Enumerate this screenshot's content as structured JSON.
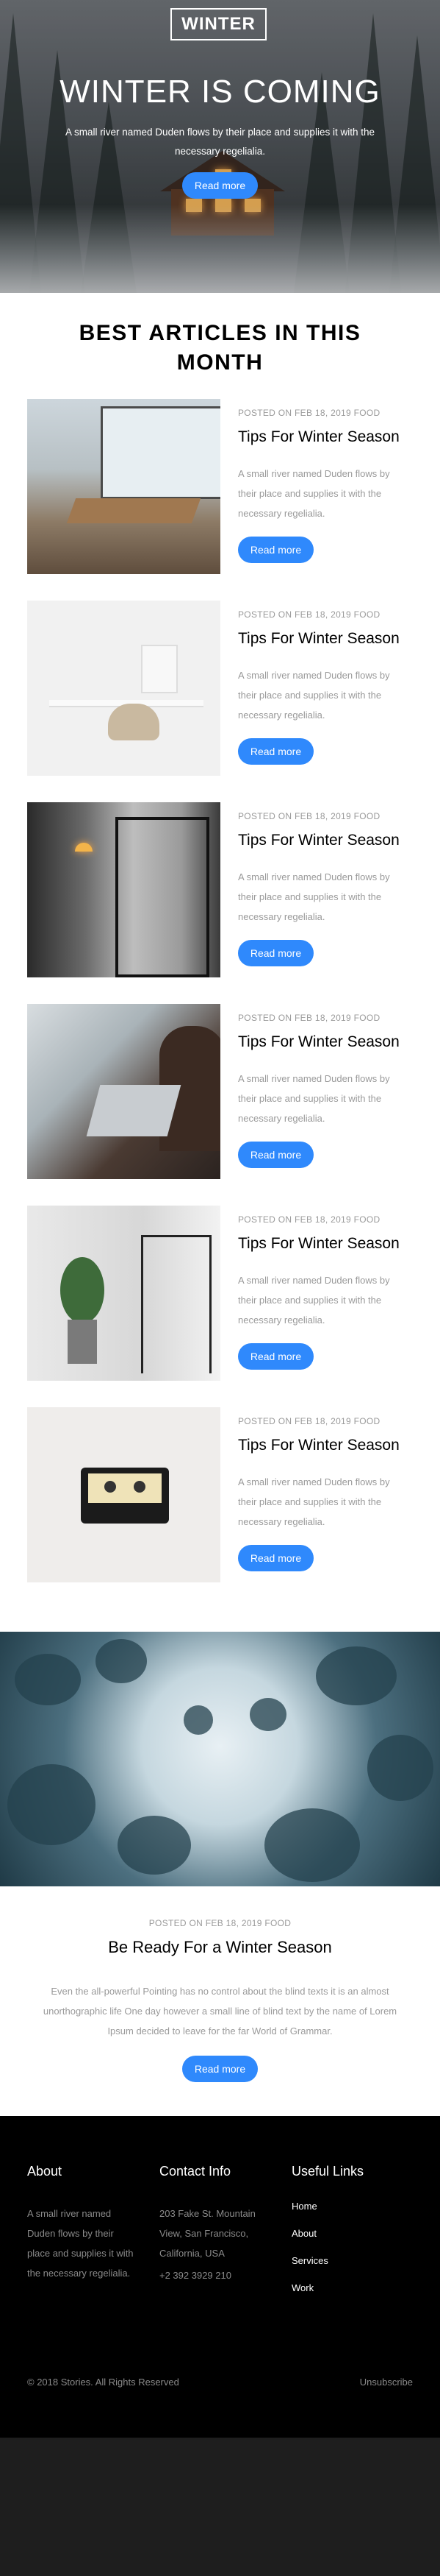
{
  "hero": {
    "logo": "WINTER",
    "title": "WINTER IS COMING",
    "text": "A small river named Duden flows by their place and supplies it with the necessary regelialia.",
    "button": "Read more"
  },
  "section_title": "BEST ARTICLES IN THIS MONTH",
  "articles": [
    {
      "meta": "POSTED ON FEB 18, 2019 FOOD",
      "title": "Tips For Winter Season",
      "text": "A small river named Duden flows by their place and supplies it with the necessary regelialia.",
      "button": "Read more"
    },
    {
      "meta": "POSTED ON FEB 18, 2019 FOOD",
      "title": "Tips For Winter Season",
      "text": "A small river named Duden flows by their place and supplies it with the necessary regelialia.",
      "button": "Read more"
    },
    {
      "meta": "POSTED ON FEB 18, 2019 FOOD",
      "title": "Tips For Winter Season",
      "text": "A small river named Duden flows by their place and supplies it with the necessary regelialia.",
      "button": "Read more"
    },
    {
      "meta": "POSTED ON FEB 18, 2019 FOOD",
      "title": "Tips For Winter Season",
      "text": "A small river named Duden flows by their place and supplies it with the necessary regelialia.",
      "button": "Read more"
    },
    {
      "meta": "POSTED ON FEB 18, 2019 FOOD",
      "title": "Tips For Winter Season",
      "text": "A small river named Duden flows by their place and supplies it with the necessary regelialia.",
      "button": "Read more"
    },
    {
      "meta": "POSTED ON FEB 18, 2019 FOOD",
      "title": "Tips For Winter Season",
      "text": "A small river named Duden flows by their place and supplies it with the necessary regelialia.",
      "button": "Read more"
    }
  ],
  "feature_post": {
    "meta": "POSTED ON FEB 18, 2019 FOOD",
    "title": "Be Ready For a Winter Season",
    "text": "Even the all-powerful Pointing has no control about the blind texts it is an almost unorthographic life One day however a small line of blind text by the name of Lorem Ipsum decided to leave for the far World of Grammar.",
    "button": "Read more"
  },
  "footer": {
    "about": {
      "heading": "About",
      "text": "A small river named Duden flows by their place and supplies it with the necessary regelialia."
    },
    "contact": {
      "heading": "Contact Info",
      "address": "203 Fake St. Mountain View, San Francisco, California, USA",
      "phone": "+2 392 3929 210"
    },
    "links": {
      "heading": "Useful Links",
      "items": [
        "Home",
        "About",
        "Services",
        "Work"
      ]
    },
    "copyright": "© 2018 Stories. All Rights Reserved",
    "unsubscribe": "Unsubscribe"
  },
  "colors": {
    "accent": "#2f89fc",
    "footer_bg": "#000000",
    "muted_text": "#9a9a9a"
  }
}
